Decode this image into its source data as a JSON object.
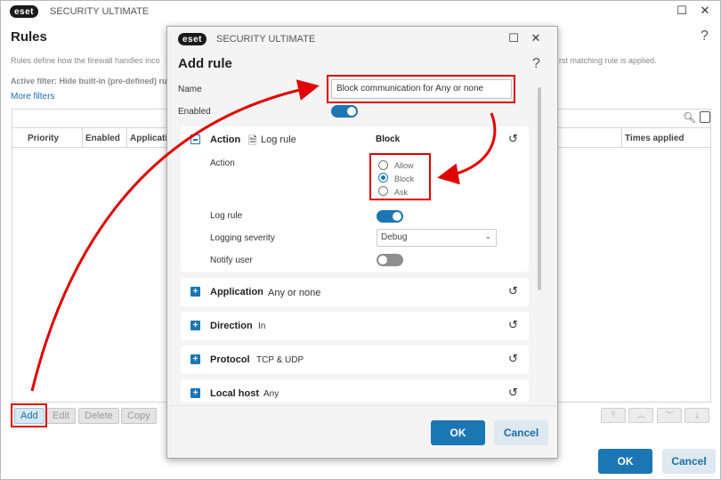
{
  "main": {
    "brand": "eset",
    "app_title": "SECURITY ULTIMATE",
    "title": "Rules",
    "help": "?",
    "description_left": "Rules define how the firewall handles inco",
    "description_right": "rst matching rule is applied.",
    "active_filter": "Active filter: Hide built-in (pre-defined) rul",
    "more_filters": "More filters",
    "columns": [
      "Priority",
      "Enabled",
      "Applicatio",
      "Times applied"
    ],
    "buttons": {
      "add": "Add",
      "edit": "Edit",
      "delete": "Delete",
      "copy": "Copy",
      "ok": "OK",
      "cancel": "Cancel"
    }
  },
  "dialog": {
    "brand": "eset",
    "app_title": "SECURITY ULTIMATE",
    "title": "Add rule",
    "help": "?",
    "name_label": "Name",
    "name_value": "Block communication for Any or none",
    "enabled_label": "Enabled",
    "enabled_on": true,
    "action_section": {
      "title": "Action",
      "log_rule_link": "Log rule",
      "value": "Block",
      "action_label": "Action",
      "options": [
        "Allow",
        "Block",
        "Ask"
      ],
      "selected": "Block",
      "log_rule_label": "Log rule",
      "log_rule_on": true,
      "logging_severity_label": "Logging severity",
      "logging_severity_value": "Debug",
      "notify_user_label": "Notify user",
      "notify_user_on": false
    },
    "sections": [
      {
        "title": "Application",
        "value": "Any or none"
      },
      {
        "title": "Direction",
        "value": "In"
      },
      {
        "title": "Protocol",
        "value": "TCP & UDP"
      },
      {
        "title": "Local host",
        "value": "Any"
      }
    ],
    "ok": "OK",
    "cancel": "Cancel"
  },
  "colors": {
    "accent": "#1b76b3",
    "annotation": "#e00000"
  }
}
